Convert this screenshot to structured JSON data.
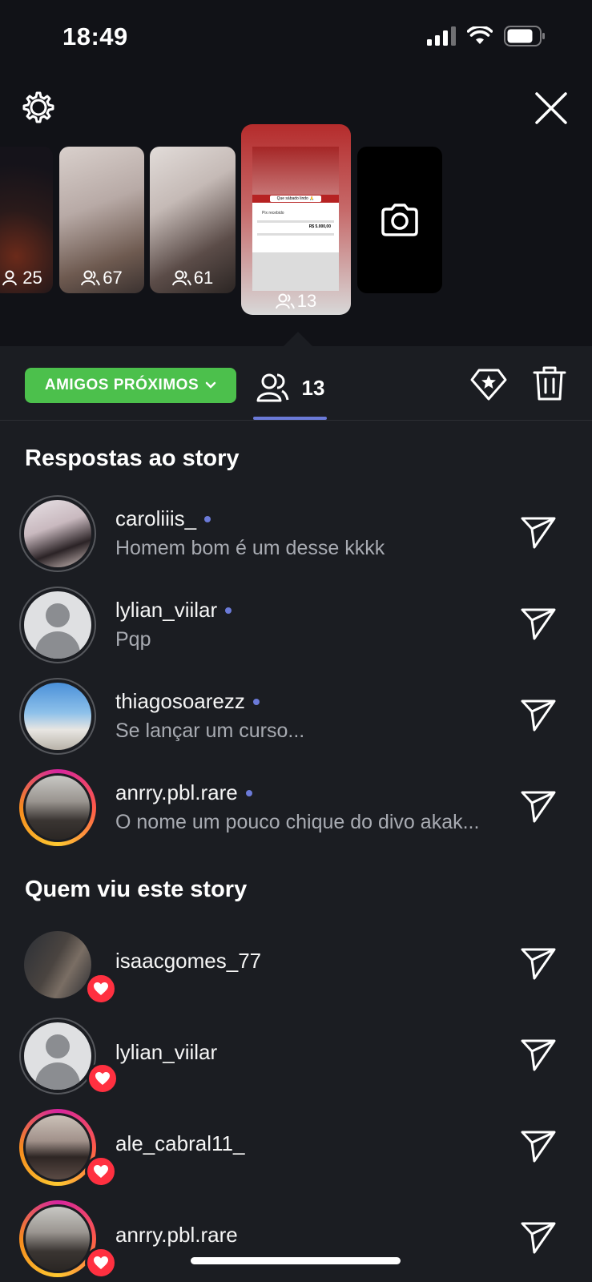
{
  "status_bar": {
    "time": "18:49"
  },
  "thumbnails": [
    {
      "count": "25"
    },
    {
      "count": "67"
    },
    {
      "count": "61"
    },
    {
      "count": "13",
      "card_title": "Que sábado lindo 🙏",
      "card_label": "Pix recebido",
      "card_amount": "R$ 5.000,00"
    }
  ],
  "toolbar": {
    "audience_label": "AMIGOS PRÓXIMOS",
    "viewer_count": "13"
  },
  "replies": {
    "title": "Respostas ao story",
    "items": [
      {
        "username": "caroliiis_",
        "message": "Homem bom é um desse kkkk"
      },
      {
        "username": "lylian_viilar",
        "message": "Pqp"
      },
      {
        "username": "thiagosoarezz",
        "message": "Se lançar um curso..."
      },
      {
        "username": "anrry.pbl.rare",
        "message": "O nome um pouco chique do divo akak..."
      }
    ]
  },
  "viewers": {
    "title": "Quem viu este story",
    "items": [
      {
        "username": "isaacgomes_77"
      },
      {
        "username": "lylian_viilar"
      },
      {
        "username": "ale_cabral11_"
      },
      {
        "username": "anrry.pbl.rare"
      }
    ]
  },
  "colors": {
    "accent": "#6b7ad8",
    "pill": "#4cc04c",
    "heart": "#ff3040"
  }
}
